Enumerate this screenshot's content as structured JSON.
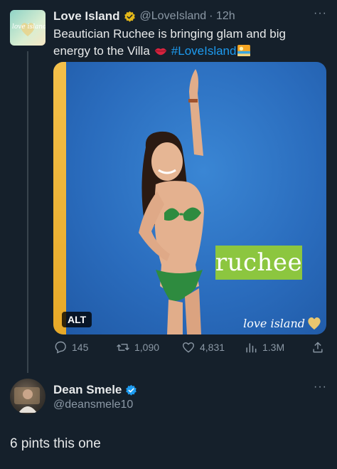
{
  "tweet": {
    "display_name": "Love Island",
    "handle": "@LoveIsland",
    "time": "· 12h",
    "text": "Beautician Ruchee is bringing glam and big energy to the Villa",
    "hashtag": "#LoveIsland",
    "avatar_text": "love island",
    "verified_color": "#e2b719",
    "image": {
      "name_card": "ruchee",
      "alt_label": "ALT",
      "logo_text": "love island"
    },
    "actions": {
      "replies": "145",
      "retweets": "1,090",
      "likes": "4,831",
      "views": "1.3M"
    }
  },
  "reply": {
    "display_name": "Dean Smele",
    "handle": "@deansmele10",
    "text": "6 pints this one",
    "verified_color": "#1d9bf0"
  },
  "more_label": "···",
  "colors": {
    "background": "#15202b",
    "link": "#1d9bf0",
    "muted": "#8b98a5"
  }
}
